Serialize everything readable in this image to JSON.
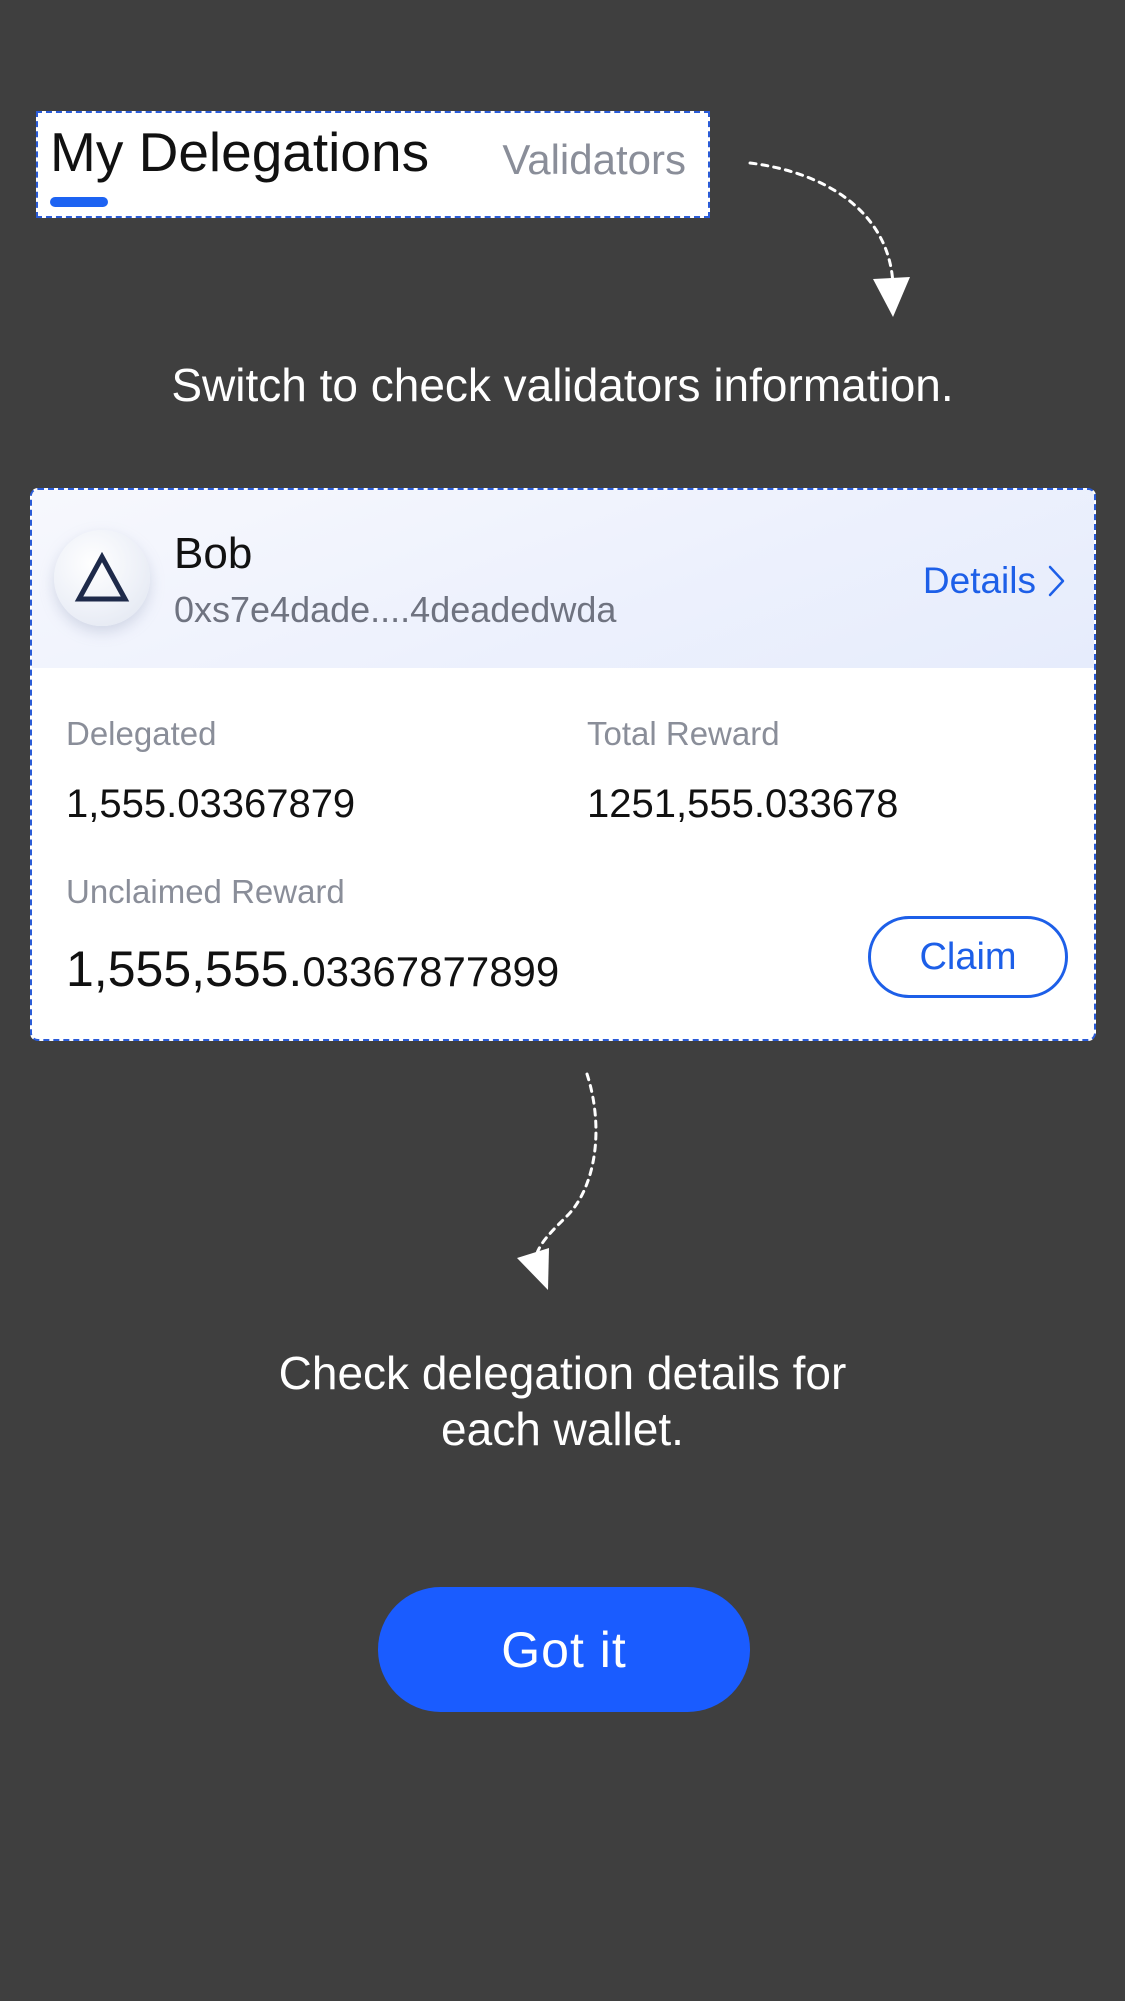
{
  "tabs": {
    "active_label": "My Delegations",
    "inactive_label": "Validators"
  },
  "hints": {
    "switch_tab": "Switch to check validators information.",
    "delegation_details": "Check delegation details for each wallet."
  },
  "card": {
    "validator_name": "Bob",
    "validator_address": "0xs7e4dade....4deadedwda",
    "details_label": "Details",
    "delegated_label": "Delegated",
    "delegated_value": "1,555.03367879",
    "total_reward_label": "Total Reward",
    "total_reward_value": "1251,555.033678",
    "unclaimed_label": "Unclaimed Reward",
    "unclaimed_value_integer": "1,555,555.",
    "unclaimed_value_decimals": "03367877899",
    "claim_label": "Claim"
  },
  "got_it_label": "Got it",
  "icons": {
    "avatar": "triangle-icon",
    "details_chevron": "chevron-right-icon",
    "arrows": "dashed-arrow-icon"
  },
  "colors": {
    "background": "#3f3f3f",
    "accent": "#1a5cff",
    "link": "#1d5fe8",
    "spotlight_border": "#2a5bd7"
  }
}
